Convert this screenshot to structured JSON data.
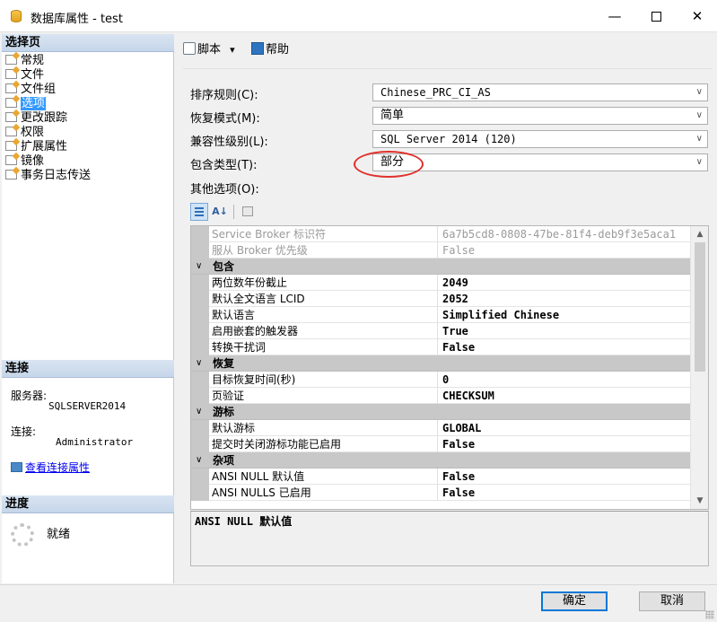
{
  "window": {
    "title": "数据库属性 - test",
    "minimize": "—",
    "maximize": "",
    "close": "✕"
  },
  "left_panel": {
    "select_page_header": "选择页",
    "pages": [
      {
        "label": "常规",
        "selected": false
      },
      {
        "label": "文件",
        "selected": false
      },
      {
        "label": "文件组",
        "selected": false
      },
      {
        "label": "选项",
        "selected": true
      },
      {
        "label": "更改跟踪",
        "selected": false
      },
      {
        "label": "权限",
        "selected": false
      },
      {
        "label": "扩展属性",
        "selected": false
      },
      {
        "label": "镜像",
        "selected": false
      },
      {
        "label": "事务日志传送",
        "selected": false
      }
    ],
    "connection_header": "连接",
    "server_label": "服务器:",
    "server_value": "SQLSERVER2014",
    "connection_label": "连接:",
    "connection_value": "Administrator",
    "view_connection_link": "查看连接属性",
    "progress_header": "进度",
    "progress_status": "就绪"
  },
  "toolbar": {
    "script_label": "脚本",
    "script_dropdown": "▾",
    "help_label": "帮助"
  },
  "form": {
    "collation_label": "排序规则(C):",
    "collation_value": "Chinese_PRC_CI_AS",
    "recovery_label": "恢复模式(M):",
    "recovery_value": "简单",
    "compat_label": "兼容性级别(L):",
    "compat_value": "SQL Server 2014 (120)",
    "containment_label": "包含类型(T):",
    "containment_value": "部分",
    "other_options_label": "其他选项(O):"
  },
  "grid": {
    "rows": [
      {
        "type": "prop",
        "name": "Service Broker 标识符",
        "value": "6a7b5cd8-0808-47be-81f4-deb9f3e5aca1",
        "disabled": true
      },
      {
        "type": "prop",
        "name": "服从 Broker 优先级",
        "value": "False",
        "disabled": true
      },
      {
        "type": "cat",
        "name": "包含"
      },
      {
        "type": "prop",
        "name": "两位数年份截止",
        "value": "2049",
        "disabled": false
      },
      {
        "type": "prop",
        "name": "默认全文语言 LCID",
        "value": "2052",
        "disabled": false
      },
      {
        "type": "prop",
        "name": "默认语言",
        "value": "Simplified Chinese",
        "disabled": false
      },
      {
        "type": "prop",
        "name": "启用嵌套的触发器",
        "value": "True",
        "disabled": false
      },
      {
        "type": "prop",
        "name": "转换干扰词",
        "value": "False",
        "disabled": false
      },
      {
        "type": "cat",
        "name": "恢复"
      },
      {
        "type": "prop",
        "name": "目标恢复时间(秒)",
        "value": "0",
        "disabled": false
      },
      {
        "type": "prop",
        "name": "页验证",
        "value": "CHECKSUM",
        "disabled": false
      },
      {
        "type": "cat",
        "name": "游标"
      },
      {
        "type": "prop",
        "name": "默认游标",
        "value": "GLOBAL",
        "disabled": false
      },
      {
        "type": "prop",
        "name": "提交时关闭游标功能已启用",
        "value": "False",
        "disabled": false
      },
      {
        "type": "cat",
        "name": "杂项"
      },
      {
        "type": "prop",
        "name": "ANSI NULL 默认值",
        "value": "False",
        "disabled": false
      },
      {
        "type": "prop",
        "name": "ANSI NULLS 已启用",
        "value": "False",
        "disabled": false
      }
    ],
    "description_title": "ANSI NULL 默认值"
  },
  "buttons": {
    "ok": "确定",
    "cancel": "取消"
  },
  "colors": {
    "accent": "#0078d7",
    "selection": "#3399ff",
    "highlight_ellipse": "#e0302c",
    "section_header": "#c6d6ea"
  }
}
